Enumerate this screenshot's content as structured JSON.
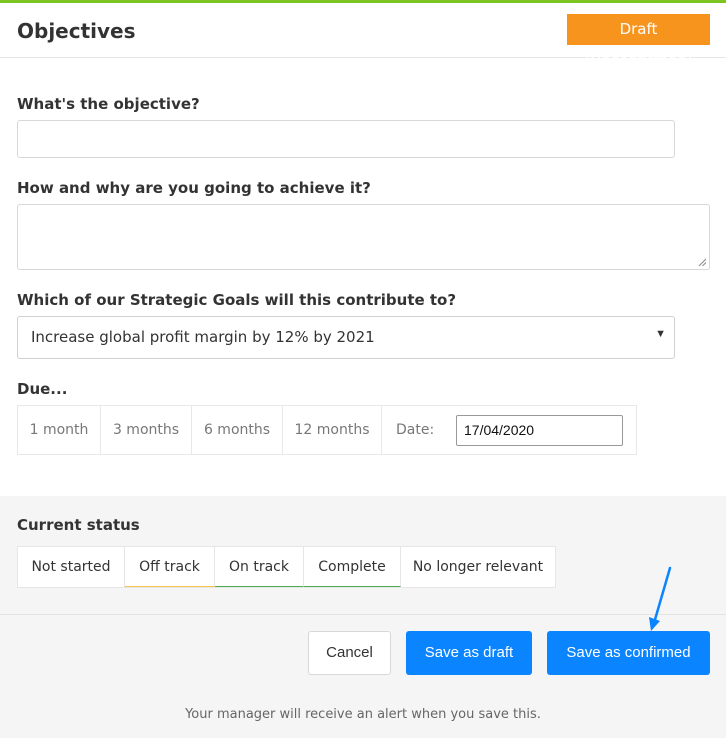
{
  "header": {
    "title": "Objectives",
    "badge": "Draft (Unconfirmed)"
  },
  "form": {
    "objective_label": "What's the objective?",
    "objective_value": "",
    "how_label": "How and why are you going to achieve it?",
    "how_value": "",
    "goal_label": "Which of our Strategic Goals will this contribute to?",
    "goal_selected": "Increase global profit margin by 12% by 2021",
    "due_label": "Due...",
    "due_options": [
      "1 month",
      "3 months",
      "6 months",
      "12 months"
    ],
    "date_label": "Date:",
    "date_value": "17/04/2020"
  },
  "status": {
    "label": "Current status",
    "options": [
      {
        "label": "Not started",
        "color": ""
      },
      {
        "label": "Off track",
        "color": "#f7c548"
      },
      {
        "label": "On track",
        "color": "#4caf50"
      },
      {
        "label": "Complete",
        "color": "#4caf50"
      },
      {
        "label": "No longer relevant",
        "color": ""
      }
    ]
  },
  "footer": {
    "cancel_label": "Cancel",
    "save_draft_label": "Save as draft",
    "save_confirmed_label": "Save as confirmed",
    "note": "Your manager will receive an alert when you save this."
  },
  "colors": {
    "accent_bar": "#7cc520",
    "badge": "#f7941d",
    "primary_button": "#0a84ff",
    "annotation_arrow": "#0a84ff"
  },
  "icons": {
    "select_caret": "caret-down-icon",
    "annotation": "arrow-pointer-icon"
  }
}
